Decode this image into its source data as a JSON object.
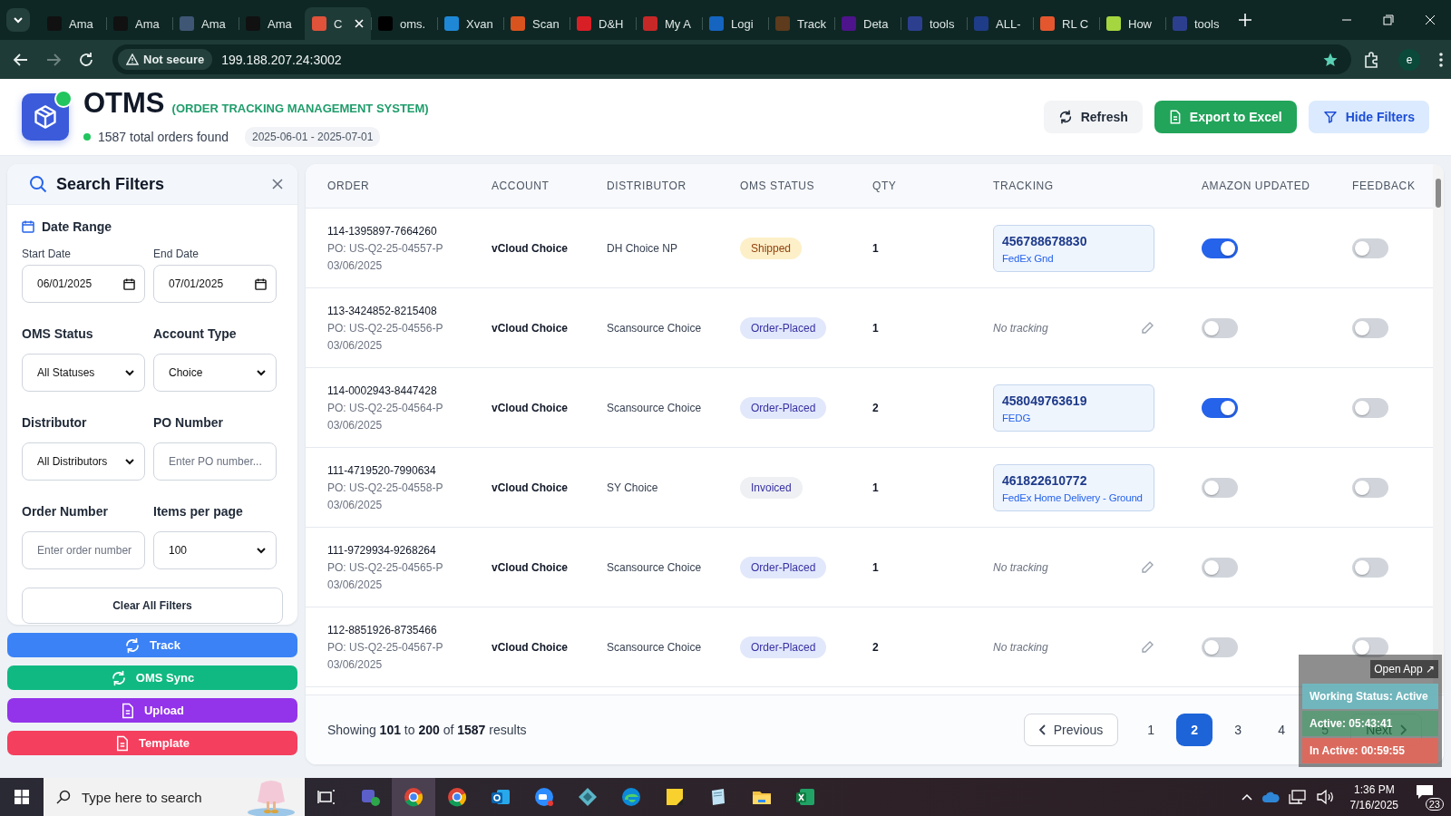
{
  "browser": {
    "tabs": [
      {
        "title": "Ama",
        "selected": false,
        "color": "#111111"
      },
      {
        "title": "Ama",
        "selected": false,
        "color": "#111111"
      },
      {
        "title": "Ama",
        "selected": false,
        "color": "#3f5775"
      },
      {
        "title": "Ama",
        "selected": false,
        "color": "#111111"
      },
      {
        "title": "C",
        "selected": true,
        "color": "#e0523a"
      },
      {
        "title": "oms.",
        "selected": false,
        "color": "#000000"
      },
      {
        "title": "Xvan",
        "selected": false,
        "color": "#1e88d6"
      },
      {
        "title": "Scan",
        "selected": false,
        "color": "#d9531e"
      },
      {
        "title": "D&H",
        "selected": false,
        "color": "#d91f26"
      },
      {
        "title": "My A",
        "selected": false,
        "color": "#c62828"
      },
      {
        "title": "Logi",
        "selected": false,
        "color": "#1565c0"
      },
      {
        "title": "Track",
        "selected": false,
        "color": "#5d3b1c"
      },
      {
        "title": "Deta",
        "selected": false,
        "color": "#4d148c"
      },
      {
        "title": "tools",
        "selected": false,
        "color": "#2c3f8f"
      },
      {
        "title": "ALL-",
        "selected": false,
        "color": "#1f3c88"
      },
      {
        "title": "RL C",
        "selected": false,
        "color": "#e4572e"
      },
      {
        "title": "How",
        "selected": false,
        "color": "#a5d63f"
      },
      {
        "title": "tools",
        "selected": false,
        "color": "#2c3f8f"
      }
    ],
    "security": "Not secure",
    "url": "199.188.207.24:3002",
    "profile": "e"
  },
  "header": {
    "title": "OTMS",
    "subtitle": "(ORDER TRACKING MANAGEMENT SYSTEM)",
    "total": "1587 total orders found",
    "date_range": "2025-06-01 - 2025-07-01",
    "actions": [
      {
        "label": "Refresh",
        "kind": "refresh"
      },
      {
        "label": "Export to Excel",
        "kind": "export"
      },
      {
        "label": "Hide Filters",
        "kind": "filter"
      }
    ]
  },
  "filters": {
    "title": "Search Filters",
    "date_range_label": "Date Range",
    "fields": [
      {
        "label": "Start Date",
        "kind": "date",
        "value": "06/01/2025"
      },
      {
        "label": "End Date",
        "kind": "date",
        "value": "07/01/2025"
      },
      {
        "label": "OMS Status",
        "kind": "select",
        "value": "All Statuses"
      },
      {
        "label": "Account Type",
        "kind": "select",
        "value": "Choice"
      },
      {
        "label": "Distributor",
        "kind": "select",
        "value": "All Distributors"
      },
      {
        "label": "PO Number",
        "kind": "text",
        "placeholder": "Enter PO number..."
      },
      {
        "label": "Order Number",
        "kind": "text",
        "placeholder": "Enter order number"
      },
      {
        "label": "Items per page",
        "kind": "select",
        "value": "100"
      }
    ],
    "clear": "Clear All Filters"
  },
  "side_actions": [
    {
      "label": "Track",
      "kind": "sync",
      "color": "#3b82f6"
    },
    {
      "label": "OMS Sync",
      "kind": "sync",
      "color": "#10b981"
    },
    {
      "label": "Upload",
      "kind": "file",
      "color": "#9333ea"
    },
    {
      "label": "Template",
      "kind": "file",
      "color": "#f43f5e"
    }
  ],
  "table": {
    "columns": [
      "ORDER",
      "ACCOUNT",
      "DISTRIBUTOR",
      "OMS STATUS",
      "QTY",
      "TRACKING",
      "AMAZON UPDATED",
      "FEEDBACK"
    ],
    "rows": [
      {
        "order": "114-1395897-7664260",
        "po": "PO: US-Q2-25-04557-P",
        "date": "03/06/2025",
        "account": "vCloud Choice",
        "distributor": "DH Choice NP",
        "status": {
          "label": "Shipped",
          "color": "#fdf0c8"
        },
        "qty": "1",
        "tracking": {
          "number": "456788678830",
          "carrier": "FedEx Gnd"
        },
        "amazon_updated": true,
        "feedback": false
      },
      {
        "order": "113-3424852-8215408",
        "po": "PO: US-Q2-25-04556-P",
        "date": "03/06/2025",
        "account": "vCloud Choice",
        "distributor": "Scansource Choice",
        "status": {
          "label": "Order-Placed",
          "color": "#e2e8fb"
        },
        "qty": "1",
        "no_tracking": "No tracking",
        "amazon_updated": false,
        "feedback": false
      },
      {
        "order": "114-0002943-8447428",
        "po": "PO: US-Q2-25-04564-P",
        "date": "03/06/2025",
        "account": "vCloud Choice",
        "distributor": "Scansource Choice",
        "status": {
          "label": "Order-Placed",
          "color": "#e2e8fb"
        },
        "qty": "2",
        "tracking": {
          "number": "458049763619",
          "carrier": "FEDG"
        },
        "amazon_updated": true,
        "feedback": false
      },
      {
        "order": "111-4719520-7990634",
        "po": "PO: US-Q2-25-04558-P",
        "date": "03/06/2025",
        "account": "vCloud Choice",
        "distributor": "SY Choice",
        "status": {
          "label": "Invoiced",
          "color": "#eef0f3"
        },
        "qty": "1",
        "tracking": {
          "number": "461822610772",
          "carrier": "FedEx Home Delivery - Ground"
        },
        "amazon_updated": false,
        "feedback": false
      },
      {
        "order": "111-9729934-9268264",
        "po": "PO: US-Q2-25-04565-P",
        "date": "03/06/2025",
        "account": "vCloud Choice",
        "distributor": "Scansource Choice",
        "status": {
          "label": "Order-Placed",
          "color": "#e2e8fb"
        },
        "qty": "1",
        "no_tracking": "No tracking",
        "amazon_updated": false,
        "feedback": false
      },
      {
        "order": "112-8851926-8735466",
        "po": "PO: US-Q2-25-04567-P",
        "date": "03/06/2025",
        "account": "vCloud Choice",
        "distributor": "Scansource Choice",
        "status": {
          "label": "Order-Placed",
          "color": "#e2e8fb"
        },
        "qty": "2",
        "no_tracking": "No tracking",
        "amazon_updated": false,
        "feedback": false
      }
    ]
  },
  "pagination": {
    "summary": "Showing **101** to **200** of **1587** results",
    "previous": "Previous",
    "next": "Next",
    "pages": [
      {
        "label": "1",
        "selected": false
      },
      {
        "label": "2",
        "selected": true
      },
      {
        "label": "3",
        "selected": false
      },
      {
        "label": "4",
        "selected": false
      },
      {
        "label": "5",
        "selected": false
      }
    ]
  },
  "status_widget": {
    "open_app": "Open App ↗",
    "working": "Working Status: Active",
    "active": "Active: 05:43:41",
    "inactive": "In Active: 00:59:55"
  },
  "taskbar": {
    "search": "Type here to search",
    "time": "1:36 PM",
    "date": "7/16/2025",
    "notifications": "23"
  }
}
